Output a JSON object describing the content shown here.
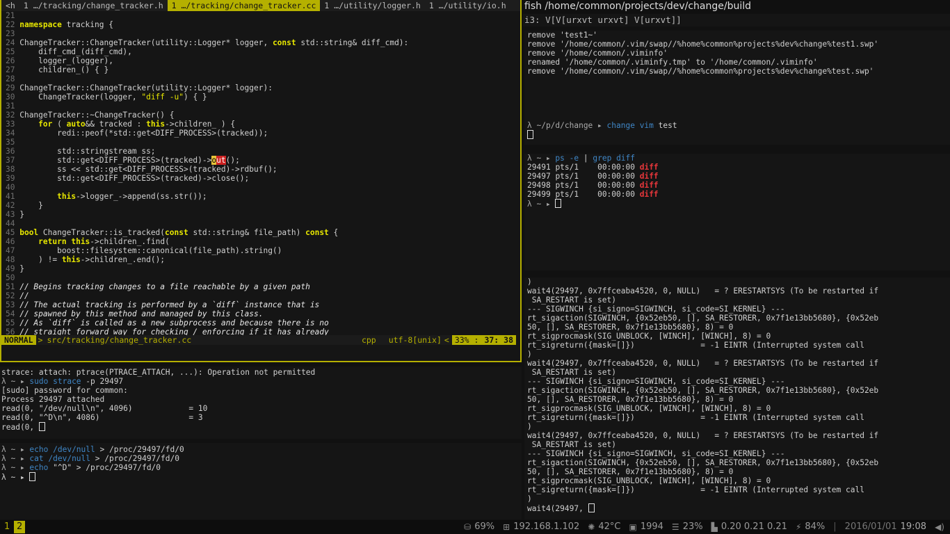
{
  "vim": {
    "tabs": [
      {
        "label": "<h",
        "active": false
      },
      {
        "label": "1 …/tracking/change_tracker.h",
        "active": false
      },
      {
        "label": "1 …/tracking/change_tracker.cc",
        "active": true
      },
      {
        "label": "1 …/utility/logger.h",
        "active": false
      },
      {
        "label": "1 …/utility/io.h",
        "active": false
      }
    ],
    "lines": [
      {
        "n": "21",
        "t": ""
      },
      {
        "n": "22",
        "t": "namespace tracking {"
      },
      {
        "n": "23",
        "t": ""
      },
      {
        "n": "24",
        "t": "ChangeTracker::ChangeTracker(utility::Logger* logger, const std::string& diff_cmd):"
      },
      {
        "n": "25",
        "t": "    diff_cmd_(diff_cmd),"
      },
      {
        "n": "26",
        "t": "    logger_(logger),"
      },
      {
        "n": "27",
        "t": "    children_() { }"
      },
      {
        "n": "28",
        "t": ""
      },
      {
        "n": "29",
        "t": "ChangeTracker::ChangeTracker(utility::Logger* logger):"
      },
      {
        "n": "30",
        "t": "    ChangeTracker(logger, \"diff -u\") { }"
      },
      {
        "n": "31",
        "t": ""
      },
      {
        "n": "32",
        "t": "ChangeTracker::~ChangeTracker() {"
      },
      {
        "n": "33",
        "t": "    for ( auto&& tracked : this->children_ ) {"
      },
      {
        "n": "34",
        "t": "        redi::peof(*std::get<DIFF_PROCESS>(tracked));"
      },
      {
        "n": "35",
        "t": ""
      },
      {
        "n": "36",
        "t": "        std::stringstream ss;"
      },
      {
        "n": "37",
        "t": "        std::get<DIFF_PROCESS>(tracked)->out();"
      },
      {
        "n": "38",
        "t": "        ss << std::get<DIFF_PROCESS>(tracked)->rdbuf();"
      },
      {
        "n": "39",
        "t": "        std::get<DIFF_PROCESS>(tracked)->close();"
      },
      {
        "n": "40",
        "t": ""
      },
      {
        "n": "41",
        "t": "        this->logger_->append(ss.str());"
      },
      {
        "n": "42",
        "t": "    }"
      },
      {
        "n": "43",
        "t": "}"
      },
      {
        "n": "44",
        "t": ""
      },
      {
        "n": "45",
        "t": "bool ChangeTracker::is_tracked(const std::string& file_path) const {"
      },
      {
        "n": "46",
        "t": "    return this->children_.find("
      },
      {
        "n": "47",
        "t": "        boost::filesystem::canonical(file_path).string()"
      },
      {
        "n": "48",
        "t": "    ) != this->children_.end();"
      },
      {
        "n": "49",
        "t": "}"
      },
      {
        "n": "50",
        "t": ""
      },
      {
        "n": "51",
        "t": "// Begins tracking changes to a file reachable by a given path"
      },
      {
        "n": "52",
        "t": "//"
      },
      {
        "n": "53",
        "t": "// The actual tracking is performed by a `diff` instance that is"
      },
      {
        "n": "54",
        "t": "// spawned by this method and managed by this class."
      },
      {
        "n": "55",
        "t": "// As `diff` is called as a new subprocess and because there is no"
      },
      {
        "n": "56",
        "t": "// straight forward way for checking / enforcing if it has already"
      }
    ],
    "status": {
      "mode": "NORMAL",
      "arrow": ">",
      "file": "src/tracking/change_tracker.cc",
      "filetype": "cpp",
      "encoding": "utf-8[unix]",
      "percent": "33% :",
      "position": "37: 38"
    }
  },
  "strace_pane": [
    "strace: attach: ptrace(PTRACE_ATTACH, ...): Operation not permitted",
    "λ ~ ▸ sudo strace -p 29497",
    "[sudo] password for common:",
    "Process 29497 attached",
    "read(0, \"/dev/null\\n\", 4096)            = 10",
    "read(0, \"^D\\n\", 4086)                   = 3",
    "read(0, "
  ],
  "echo_pane": [
    "λ ~ ▸ echo /dev/null > /proc/29497/fd/0",
    "λ ~ ▸ cat /dev/null > /proc/29497/fd/0",
    "λ ~ ▸ echo \"^D\" > /proc/29497/fd/0",
    "λ ~ ▸ "
  ],
  "right_title": "fish  /home/common/projects/dev/change/build",
  "i3_title": "i3: V[V[urxvt urxvt] V[urxvt]]",
  "fish_top": {
    "lines": [
      "remove 'test1~'",
      "remove '/home/common/.vim/swap//%home%common%projects%dev%change%test1.swp'",
      "remove '/home/common/.viminfo'",
      "renamed '/home/common/.viminfy.tmp' to '/home/common/.viminfo'",
      "remove '/home/common/.vim/swap//%home%common%projects%dev%change%test.swp'"
    ],
    "prompt": "λ ~/p/d/change ▸ change vim test"
  },
  "ps_pane": {
    "command": "λ ~ ▸ ps -e | grep diff",
    "rows": [
      {
        "pid": "29491",
        "tty": "pts/1",
        "time": "00:00:00",
        "cmd": "diff"
      },
      {
        "pid": "29497",
        "tty": "pts/1",
        "time": "00:00:00",
        "cmd": "diff"
      },
      {
        "pid": "29498",
        "tty": "pts/1",
        "time": "00:00:00",
        "cmd": "diff"
      },
      {
        "pid": "29499",
        "tty": "pts/1",
        "time": "00:00:00",
        "cmd": "diff"
      }
    ],
    "prompt": "λ ~ ▸ "
  },
  "strace_right": [
    ")",
    "wait4(29497, 0x7ffceaba4520, 0, NULL)   = ? ERESTARTSYS (To be restarted if",
    " SA_RESTART is set)",
    "--- SIGWINCH {si_signo=SIGWINCH, si_code=SI_KERNEL} ---",
    "rt_sigaction(SIGWINCH, {0x52eb50, [], SA_RESTORER, 0x7f1e13bb5680}, {0x52eb",
    "50, [], SA_RESTORER, 0x7f1e13bb5680}, 8) = 0",
    "rt_sigprocmask(SIG_UNBLOCK, [WINCH], [WINCH], 8) = 0",
    "rt_sigreturn({mask=[]})              = -1 EINTR (Interrupted system call",
    ")",
    "wait4(29497, 0x7ffceaba4520, 0, NULL)   = ? ERESTARTSYS (To be restarted if",
    " SA_RESTART is set)",
    "--- SIGWINCH {si_signo=SIGWINCH, si_code=SI_KERNEL} ---",
    "rt_sigaction(SIGWINCH, {0x52eb50, [], SA_RESTORER, 0x7f1e13bb5680}, {0x52eb",
    "50, [], SA_RESTORER, 0x7f1e13bb5680}, 8) = 0",
    "rt_sigprocmask(SIG_UNBLOCK, [WINCH], [WINCH], 8) = 0",
    "rt_sigreturn({mask=[]})              = -1 EINTR (Interrupted system call",
    ")",
    "wait4(29497, 0x7ffceaba4520, 0, NULL)   = ? ERESTARTSYS (To be restarted if",
    " SA_RESTART is set)",
    "--- SIGWINCH {si_signo=SIGWINCH, si_code=SI_KERNEL} ---",
    "rt_sigaction(SIGWINCH, {0x52eb50, [], SA_RESTORER, 0x7f1e13bb5680}, {0x52eb",
    "50, [], SA_RESTORER, 0x7f1e13bb5680}, 8) = 0",
    "rt_sigprocmask(SIG_UNBLOCK, [WINCH], [WINCH], 8) = 0",
    "rt_sigreturn({mask=[]})              = -1 EINTR (Interrupted system call",
    ")",
    "wait4(29497, "
  ],
  "bar": {
    "workspaces": [
      {
        "label": "1",
        "focused": false
      },
      {
        "label": "2",
        "focused": true
      }
    ],
    "disk": "69%",
    "ip": "192.168.1.102",
    "temp": "42°C",
    "freq": "1994",
    "mem": "23%",
    "load": "0.20  0.21  0.21",
    "battery": "84%",
    "date": "2016/01/01",
    "time": "19:08",
    "icons": {
      "disk": "drive-icon",
      "net": "network-icon",
      "temp": "thermometer-icon",
      "cpu": "cpu-icon",
      "mem": "memory-icon",
      "load": "chart-icon",
      "battery": "plug-icon",
      "volume": "speaker-icon"
    }
  },
  "colors": {
    "accent": "#b5b000",
    "error": "#e8363b",
    "command": "#3f86c6"
  }
}
